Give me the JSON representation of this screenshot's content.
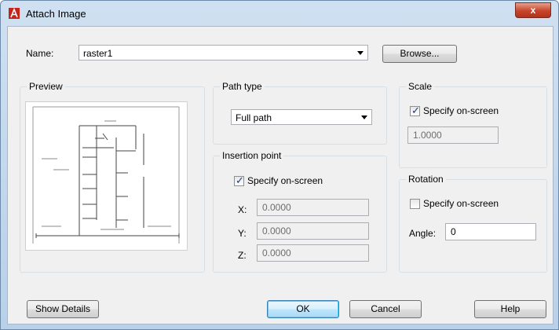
{
  "window": {
    "title": "Attach Image",
    "close_glyph": "x"
  },
  "name": {
    "label": "Name:",
    "value": "raster1",
    "browse_label": "Browse..."
  },
  "preview": {
    "title": "Preview"
  },
  "path_type": {
    "title": "Path type",
    "value": "Full path"
  },
  "insertion_point": {
    "title": "Insertion point",
    "specify_label": "Specify on-screen",
    "specify_checked": true,
    "x_label": "X:",
    "x_value": "0.0000",
    "y_label": "Y:",
    "y_value": "0.0000",
    "z_label": "Z:",
    "z_value": "0.0000"
  },
  "scale": {
    "title": "Scale",
    "specify_label": "Specify on-screen",
    "specify_checked": true,
    "value": "1.0000"
  },
  "rotation": {
    "title": "Rotation",
    "specify_label": "Specify on-screen",
    "specify_checked": false,
    "angle_label": "Angle:",
    "angle_value": "0"
  },
  "buttons": {
    "show_details": "Show Details",
    "ok": "OK",
    "cancel": "Cancel",
    "help": "Help"
  },
  "check_glyph": "✓",
  "icons": {
    "app": "autocad-icon",
    "close": "close-icon",
    "dropdown": "chevron-down-icon"
  },
  "colors": {
    "title_bg": "#c3d7ec",
    "close_bg": "#c7442a",
    "ok_border": "#3c7fb1"
  }
}
